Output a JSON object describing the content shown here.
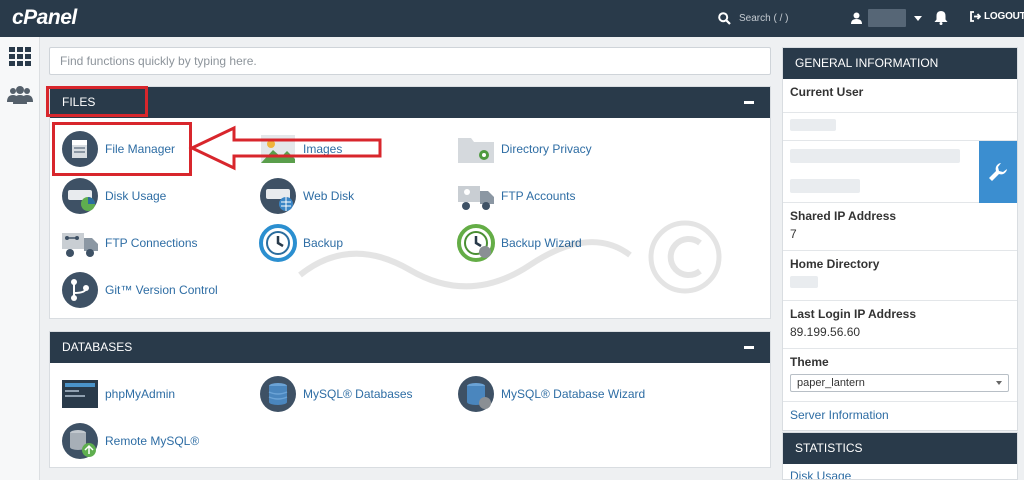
{
  "header": {
    "logo": "cPanel",
    "search_placeholder": "Search ( / )",
    "logout_label": "LOGOUT"
  },
  "search": {
    "placeholder": "Find functions quickly by typing here."
  },
  "files": {
    "title": "FILES",
    "items": [
      {
        "label": "File Manager"
      },
      {
        "label": "Images"
      },
      {
        "label": "Directory Privacy"
      },
      {
        "label": "Disk Usage"
      },
      {
        "label": "Web Disk"
      },
      {
        "label": "FTP Accounts"
      },
      {
        "label": "FTP Connections"
      },
      {
        "label": "Backup"
      },
      {
        "label": "Backup Wizard"
      },
      {
        "label": "Git™ Version Control"
      }
    ]
  },
  "databases": {
    "title": "DATABASES",
    "items": [
      {
        "label": "phpMyAdmin"
      },
      {
        "label": "MySQL® Databases"
      },
      {
        "label": "MySQL® Database Wizard"
      },
      {
        "label": "Remote MySQL®"
      }
    ]
  },
  "general_info": {
    "title": "GENERAL INFORMATION",
    "current_user_label": "Current User",
    "shared_ip_label": "Shared IP Address",
    "shared_ip_value": "7",
    "home_dir_label": "Home Directory",
    "last_login_label": "Last Login IP Address",
    "last_login_value": "89.199.56.60",
    "theme_label": "Theme",
    "theme_value": "paper_lantern",
    "server_info_link": "Server Information"
  },
  "statistics": {
    "title": "STATISTICS",
    "first_item": "Disk Usage"
  },
  "colors": {
    "header_bg": "#293a4a",
    "link": "#2e6da4",
    "highlight": "#d8262c",
    "wrench_bg": "#3b8ed0"
  }
}
